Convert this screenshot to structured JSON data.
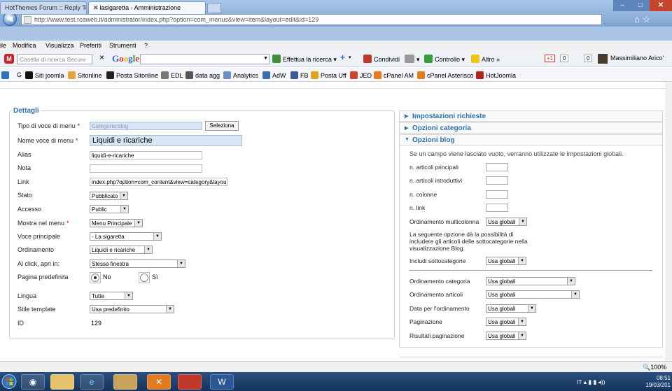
{
  "browser": {
    "url": "http://www.test.rcaweb.it/administrator/index.php?option=com_menus&view=item&layout=edit&id=129",
    "tabs": [
      {
        "label": "HotThemes Forum :: Reply To..."
      },
      {
        "label": "lasigaretta - Amministrazione"
      }
    ],
    "menu": [
      "ile",
      "Modifica",
      "Visualizza",
      "Preferiti",
      "Strumenti",
      "?"
    ],
    "toolbar": {
      "search_placeholder": "Casella di ricerca Secure",
      "close": "×",
      "google": "Google",
      "search_button": "Effettua la ricerca",
      "plus": "+",
      "share": "Condividi",
      "check": "Controllo",
      "more": "Altro »",
      "gplus": "+1",
      "gplus_count": "0",
      "count2": "0",
      "user": "Massimiliano Arico'"
    },
    "bookmarks": [
      {
        "label": "G",
        "color": "#1e5fb3"
      },
      {
        "label": "Siti joomla",
        "color": "#111111"
      },
      {
        "label": "Sitonline",
        "color": "#e8a23a"
      },
      {
        "label": "Posta Sitonline",
        "color": "#222222"
      },
      {
        "label": "EDL",
        "color": "#777777"
      },
      {
        "label": "data agg",
        "color": "#555555"
      },
      {
        "label": "Analytics",
        "color": "#6b8fbf"
      },
      {
        "label": "AdW",
        "color": "#3a6fb6"
      },
      {
        "label": "FB",
        "color": "#3b5998"
      },
      {
        "label": "Posta Uff",
        "color": "#e3a31f"
      },
      {
        "label": "JED",
        "color": "#d1432f"
      },
      {
        "label": "cPanel AM",
        "color": "#e57b1c"
      },
      {
        "label": "cPanel Asterisco",
        "color": "#e57b1c"
      },
      {
        "label": "HotJoomla",
        "color": "#b3261e"
      }
    ],
    "status_zoom": "100%"
  },
  "dettagli": {
    "legend": "Dettagli",
    "fields": {
      "tipo_label": "Tipo di voce di menu",
      "tipo_value": "Categoria blog",
      "seleziona": "Seleziona",
      "nome_label": "Nome voce di menu",
      "nome_value": "Liquidi e ricariche",
      "alias_label": "Alias",
      "alias_value": "liquidi-e-ricariche",
      "nota_label": "Nota",
      "nota_value": "",
      "link_label": "Link",
      "link_value": "index.php?option=com_content&view=category&layout",
      "stato_label": "Stato",
      "stato_value": "Pubblicato",
      "accesso_label": "Accesso",
      "accesso_value": "Public",
      "mostra_label": "Mostra nel menu",
      "mostra_value": "Menu Principale",
      "voce_label": "Voce principale",
      "voce_value": "- La sigaretta",
      "ordinamento_label": "Ordinamento",
      "ordinamento_value": "Liquidi e ricariche",
      "click_label": "Al click, apri in:",
      "click_value": "Stessa finestra",
      "pagina_label": "Pagina predefinita",
      "pagina_no": "No",
      "pagina_si": "Sì",
      "lingua_label": "Lingua",
      "lingua_value": "Tutte",
      "stile_label": "Stile template",
      "stile_value": "Usa predefinito",
      "id_label": "ID",
      "id_value": "129"
    },
    "required_mark": "*"
  },
  "right_panel": {
    "impostazioni": "Impostazioni richieste",
    "opzioni_categoria": "Opzioni categoria",
    "opzioni_blog": "Opzioni blog",
    "note": "Se un campo viene lasciato vuoto, verranno utilizzate le impostazioni globali.",
    "articoli_principali": "n. articoli principali",
    "articoli_introduttivi": "n. articoli introduttivi",
    "colonne": "n. colonne",
    "link": "n. link",
    "multicolonna_label": "Ordinamento multicolonna",
    "multicolonna_value": "Usa globali",
    "paragraph": [
      "La seguente opzione dà la possibilità di",
      "includere gli articoli delle sottocategorie nella",
      "visualizzazione Blog."
    ],
    "sottocategorie_label": "Includi sottocategorie",
    "sottocategorie_value": "Usa globali",
    "ord_categoria_label": "Ordinamento categoria",
    "ord_categoria_value": "Usa globali",
    "ord_articoli_label": "Ordinamento articoli",
    "ord_articoli_value": "Usa globali",
    "data_label": "Data per l'ordinamento",
    "data_value": "Usa globali",
    "paginazione_label": "Paginazione",
    "paginazione_value": "Usa globali",
    "risultati_label": "Risultati paginazione",
    "risultati_value": "Usa globali"
  },
  "taskbar": {
    "lang": "IT",
    "time": "08:51",
    "date": "19/03/201"
  }
}
